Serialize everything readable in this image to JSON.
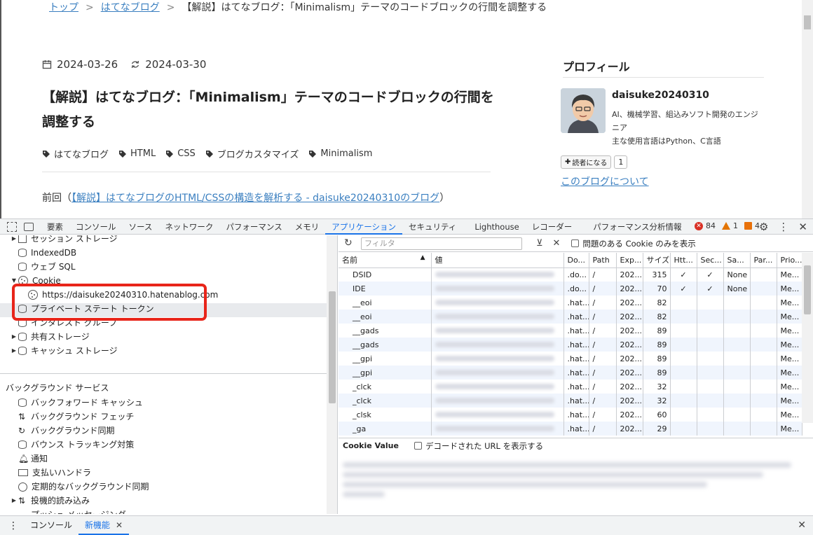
{
  "breadcrumb": {
    "home": "トップ",
    "sep": ">",
    "blog": "はてなブログ",
    "current": "【解説】はてなブログ：「Minimalism」テーマのコードブロックの行間を調整する"
  },
  "article": {
    "published": "2024-03-26",
    "updated": "2024-03-30",
    "title": "【解説】はてなブログ：「Minimalism」テーマのコードブロックの行間を調整する",
    "tags": [
      "はてなブログ",
      "HTML",
      "CSS",
      "ブログカスタマイズ",
      "Minimalism"
    ],
    "prev_prefix": "前回（",
    "prev_link": "【解説】はてなブログのHTML/CSSの構造を解析する - daisuke20240310のブログ",
    "prev_suffix": "）"
  },
  "profile": {
    "heading": "プロフィール",
    "name": "daisuke20240310",
    "desc1": "AI、機械学習、組込みソフト開発のエンジニア",
    "desc2": "主な使用言語はPython、C言語",
    "follow_label": "読者になる",
    "follow_count": "1",
    "about_link": "このブログについて"
  },
  "devtools": {
    "tabs": [
      "要素",
      "コンソール",
      "ソース",
      "ネットワーク",
      "パフォーマンス",
      "メモリ",
      "アプリケーション",
      "セキュリティ",
      "Lighthouse",
      "レコーダー",
      "パフォーマンス分析情報"
    ],
    "active_tab": "アプリケーション",
    "errors": "84",
    "warnings": "1",
    "issues": "4",
    "tree": {
      "session_storage": "セッション ストレージ",
      "indexeddb": "IndexedDB",
      "websql": "ウェブ SQL",
      "cookie": "Cookie",
      "cookie_origin": "https://daisuke20240310.hatenablog.com",
      "private_state": "プライベート ステート トークン",
      "interest_groups": "インタレスト グループ",
      "shared_storage": "共有ストレージ",
      "cache_storage": "キャッシュ ストレージ"
    },
    "background": {
      "heading": "バックグラウンド サービス",
      "items": [
        "バックフォワード キャッシュ",
        "バックグラウンド フェッチ",
        "バックグラウンド同期",
        "バウンス トラッキング対策",
        "通知",
        "支払いハンドラ",
        "定期的なバックグラウンド同期",
        "投機的読み込み",
        "プッシュ メッセージング"
      ]
    },
    "filter_placeholder": "フィルタ",
    "only_issues_label": "問題のある Cookie のみを表示",
    "columns": [
      "名前",
      "値",
      "Do...",
      "Path",
      "Exp...",
      "サイズ",
      "Htt...",
      "Sec...",
      "Sa...",
      "Par...",
      "Prio..."
    ],
    "rows": [
      {
        "name": "DSID",
        "domain": ".do...",
        "path": "/",
        "exp": "202...",
        "size": "315",
        "http": "✓",
        "secure": "✓",
        "same": "None",
        "prio": "Me..."
      },
      {
        "name": "IDE",
        "domain": ".do...",
        "path": "/",
        "exp": "202...",
        "size": "70",
        "http": "✓",
        "secure": "✓",
        "same": "None",
        "prio": "Me..."
      },
      {
        "name": "__eoi",
        "domain": ".hat...",
        "path": "/",
        "exp": "202...",
        "size": "82",
        "http": "",
        "secure": "",
        "same": "",
        "prio": "Me..."
      },
      {
        "name": "__eoi",
        "domain": ".hat...",
        "path": "/",
        "exp": "202...",
        "size": "82",
        "http": "",
        "secure": "",
        "same": "",
        "prio": "Me..."
      },
      {
        "name": "__gads",
        "domain": ".hat...",
        "path": "/",
        "exp": "202...",
        "size": "89",
        "http": "",
        "secure": "",
        "same": "",
        "prio": "Me..."
      },
      {
        "name": "__gads",
        "domain": ".hat...",
        "path": "/",
        "exp": "202...",
        "size": "89",
        "http": "",
        "secure": "",
        "same": "",
        "prio": "Me..."
      },
      {
        "name": "__gpi",
        "domain": ".hat...",
        "path": "/",
        "exp": "202...",
        "size": "89",
        "http": "",
        "secure": "",
        "same": "",
        "prio": "Me..."
      },
      {
        "name": "__gpi",
        "domain": ".hat...",
        "path": "/",
        "exp": "202...",
        "size": "89",
        "http": "",
        "secure": "",
        "same": "",
        "prio": "Me..."
      },
      {
        "name": "_clck",
        "domain": ".hat...",
        "path": "/",
        "exp": "202...",
        "size": "32",
        "http": "",
        "secure": "",
        "same": "",
        "prio": "Me..."
      },
      {
        "name": "_clck",
        "domain": ".hat...",
        "path": "/",
        "exp": "202...",
        "size": "32",
        "http": "",
        "secure": "",
        "same": "",
        "prio": "Me..."
      },
      {
        "name": "_clsk",
        "domain": ".hat...",
        "path": "/",
        "exp": "202...",
        "size": "60",
        "http": "",
        "secure": "",
        "same": "",
        "prio": "Me..."
      },
      {
        "name": "_ga",
        "domain": ".hat...",
        "path": "/",
        "exp": "202...",
        "size": "29",
        "http": "",
        "secure": "",
        "same": "",
        "prio": "Me..."
      }
    ],
    "cookie_value_label": "Cookie Value",
    "decode_label": "デコードされた URL を表示する",
    "drawer_tabs": [
      "コンソール",
      "新機能"
    ]
  }
}
